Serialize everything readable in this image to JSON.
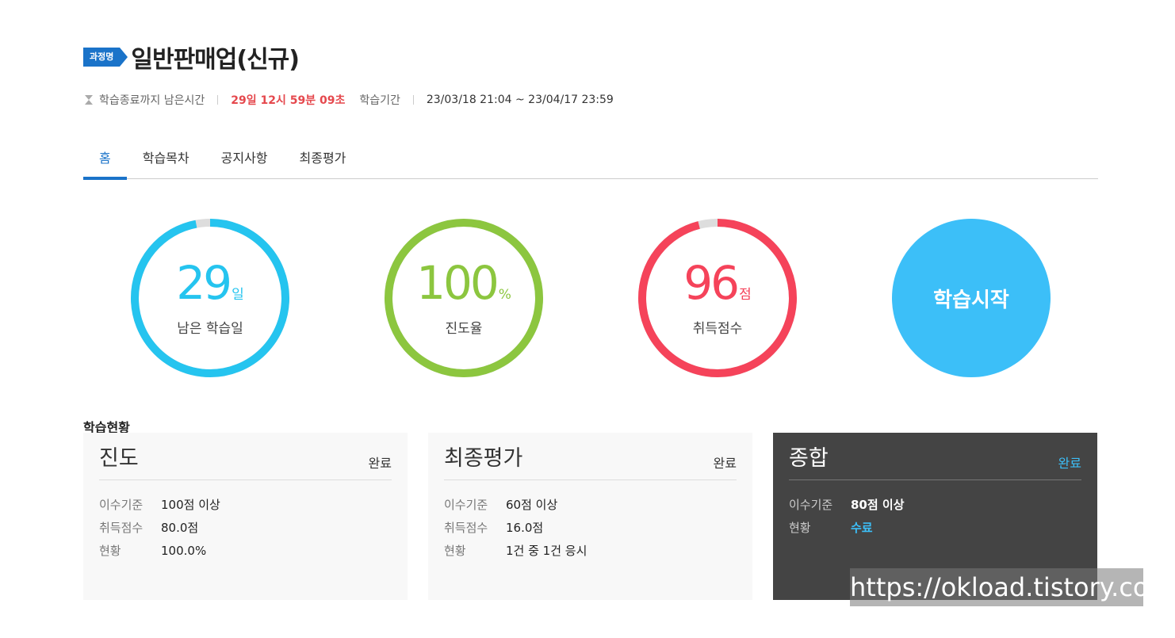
{
  "header": {
    "badge": "과정명",
    "course_title": "일반판매업(신규)"
  },
  "meta": {
    "remaining_label": "학습종료까지 남은시간",
    "remaining_value": "29일 12시 59분 09초",
    "period_label": "학습기간",
    "period_value": "23/03/18 21:04 ~ 23/04/17 23:59"
  },
  "tabs": [
    {
      "label": "홈",
      "active": true
    },
    {
      "label": "학습목차",
      "active": false
    },
    {
      "label": "공지사항",
      "active": false
    },
    {
      "label": "최종평가",
      "active": false
    }
  ],
  "circles": [
    {
      "number": "29",
      "unit": "일",
      "label": "남은 학습일",
      "color": "#25c4ef",
      "fraction": 0.97
    },
    {
      "number": "100",
      "unit": "%",
      "label": "진도율",
      "color": "#8cc63f",
      "fraction": 1.0
    },
    {
      "number": "96",
      "unit": "점",
      "label": "취득점수",
      "color": "#f5435a",
      "fraction": 0.96
    }
  ],
  "start_button": "학습시작",
  "section_title": "학습현황",
  "cards": [
    {
      "title": "진도",
      "status": "완료",
      "rows": [
        {
          "k": "이수기준",
          "v": "100점 이상"
        },
        {
          "k": "취득점수",
          "v": "80.0점"
        },
        {
          "k": "현황",
          "v": "100.0%"
        }
      ]
    },
    {
      "title": "최종평가",
      "status": "완료",
      "rows": [
        {
          "k": "이수기준",
          "v": "60점 이상"
        },
        {
          "k": "취득점수",
          "v": "16.0점"
        },
        {
          "k": "현황",
          "v": "1건 중 1건 응시"
        }
      ]
    },
    {
      "title": "종합",
      "status": "완료",
      "rows": [
        {
          "k": "이수기준",
          "v": "80점 이상"
        },
        {
          "k": "현황",
          "v": "수료"
        }
      ]
    }
  ],
  "watermark": "https://okload.tistory.com",
  "colors": {
    "accent_blue": "#1a73c9",
    "sky": "#3cbff8",
    "red": "#e5484d",
    "track": "#dddddd"
  }
}
